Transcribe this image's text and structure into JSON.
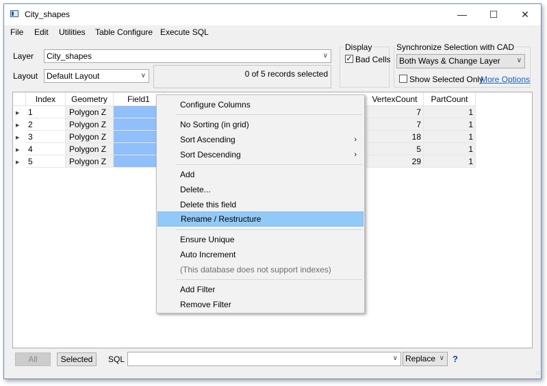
{
  "window": {
    "title": "City_shapes",
    "minimize": "—",
    "maximize": "☐",
    "close": "✕"
  },
  "menu": [
    "File",
    "Edit",
    "Utilities",
    "Table Configure",
    "Execute SQL"
  ],
  "layer": {
    "label": "Layer",
    "value": "City_shapes"
  },
  "layout": {
    "label": "Layout",
    "value": "Default Layout"
  },
  "records_status": "0 of 5 records selected",
  "display": {
    "label": "Display",
    "bad_cells_label": "Bad Cells",
    "bad_cells_checked": true
  },
  "sync": {
    "label": "Synchronize Selection with CAD",
    "value": "Both Ways & Change Layer",
    "show_selected_only_label": "Show Selected Only",
    "show_selected_only_checked": false,
    "more_options": "More Options"
  },
  "grid": {
    "headers": [
      "Index",
      "Geometry",
      "Field1",
      "VertexCount",
      "PartCount"
    ],
    "rows": [
      {
        "index": "1",
        "geometry": "Polygon Z",
        "field1": "",
        "vertex": "7",
        "parts": "1"
      },
      {
        "index": "2",
        "geometry": "Polygon Z",
        "field1": "",
        "vertex": "7",
        "parts": "1"
      },
      {
        "index": "3",
        "geometry": "Polygon Z",
        "field1": "",
        "vertex": "18",
        "parts": "1"
      },
      {
        "index": "4",
        "geometry": "Polygon Z",
        "field1": "",
        "vertex": "5",
        "parts": "1"
      },
      {
        "index": "5",
        "geometry": "Polygon Z",
        "field1": "",
        "vertex": "29",
        "parts": "1"
      }
    ]
  },
  "context_menu": {
    "configure_columns": "Configure Columns",
    "no_sorting": "No Sorting (in grid)",
    "sort_ascending": "Sort Ascending",
    "sort_descending": "Sort Descending",
    "add": "Add",
    "delete": "Delete...",
    "delete_field": "Delete this field",
    "rename": "Rename / Restructure",
    "ensure_unique": "Ensure Unique",
    "auto_increment": "Auto Increment",
    "no_indexes": "(This database does not support indexes)",
    "add_filter": "Add Filter",
    "remove_filter": "Remove Filter"
  },
  "bottom": {
    "all_button": "All",
    "selected_button": "Selected",
    "sql_label": "SQL",
    "sql_value": "",
    "replace_value": "Replace",
    "help": "?"
  },
  "icons": {
    "submenu_arrow": "›",
    "dropdown_arrow": "∨",
    "row_marker": "▶",
    "check": "✓",
    "resize_grip": "∷"
  }
}
